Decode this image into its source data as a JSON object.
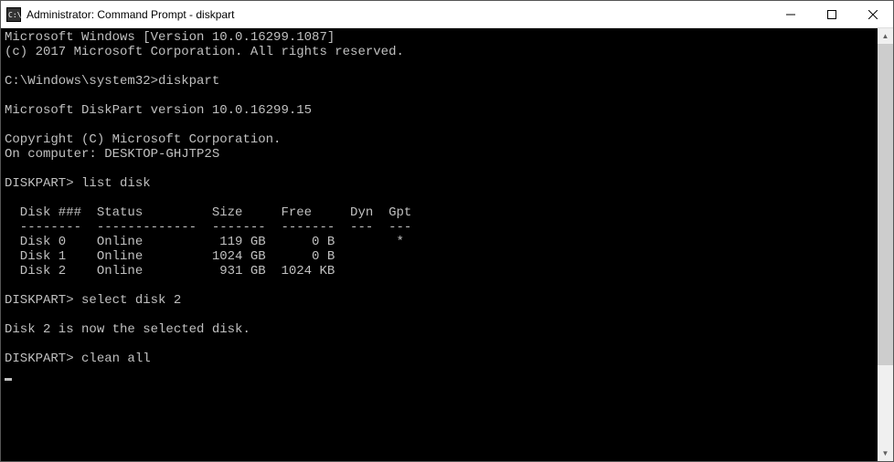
{
  "window": {
    "title": "Administrator: Command Prompt - diskpart"
  },
  "terminal": {
    "line1": "Microsoft Windows [Version 10.0.16299.1087]",
    "line2": "(c) 2017 Microsoft Corporation. All rights reserved.",
    "blank1": "",
    "prompt1": "C:\\Windows\\system32>diskpart",
    "blank2": "",
    "line3": "Microsoft DiskPart version 10.0.16299.15",
    "blank3": "",
    "line4": "Copyright (C) Microsoft Corporation.",
    "line5": "On computer: DESKTOP-GHJTP2S",
    "blank4": "",
    "prompt2": "DISKPART> list disk",
    "blank5": "",
    "header": "  Disk ###  Status         Size     Free     Dyn  Gpt",
    "sep": "  --------  -------------  -------  -------  ---  ---",
    "row0": "  Disk 0    Online          119 GB      0 B        *",
    "row1": "  Disk 1    Online         1024 GB      0 B",
    "row2": "  Disk 2    Online          931 GB  1024 KB",
    "blank6": "",
    "prompt3": "DISKPART> select disk 2",
    "blank7": "",
    "line6": "Disk 2 is now the selected disk.",
    "blank8": "",
    "prompt4": "DISKPART> clean all"
  },
  "disk_table": {
    "columns": [
      "Disk ###",
      "Status",
      "Size",
      "Free",
      "Dyn",
      "Gpt"
    ],
    "rows": [
      {
        "disk": "Disk 0",
        "status": "Online",
        "size": "119 GB",
        "free": "0 B",
        "dyn": "",
        "gpt": "*"
      },
      {
        "disk": "Disk 1",
        "status": "Online",
        "size": "1024 GB",
        "free": "0 B",
        "dyn": "",
        "gpt": ""
      },
      {
        "disk": "Disk 2",
        "status": "Online",
        "size": "931 GB",
        "free": "1024 KB",
        "dyn": "",
        "gpt": ""
      }
    ]
  }
}
